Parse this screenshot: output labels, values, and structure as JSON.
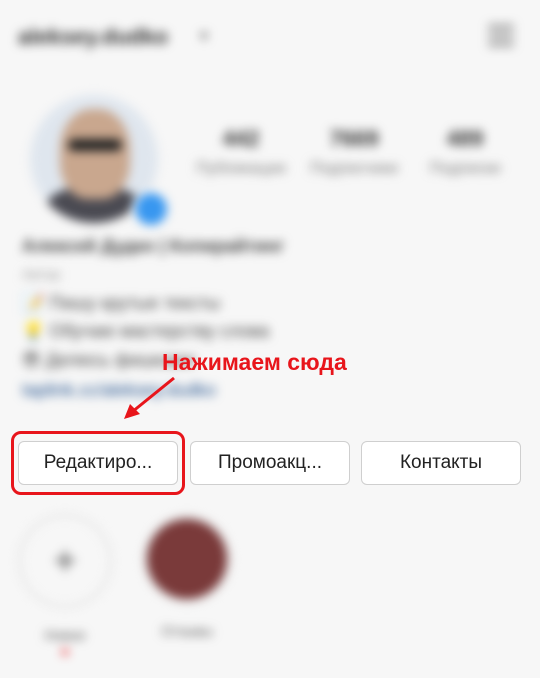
{
  "header": {
    "username": "aleksey.dudko",
    "chevron_icon": "chevron-down-icon",
    "menu_icon": "hamburger-menu-icon"
  },
  "profile": {
    "avatar_icon": "profile-photo",
    "add_story_icon": "plus-badge-icon",
    "stats": [
      {
        "value": "442",
        "label": "Публикации"
      },
      {
        "value": "7669",
        "label": "Подписчики"
      },
      {
        "value": "489",
        "label": "Подписки"
      }
    ]
  },
  "bio": {
    "name": "Алексей Дудко | Копирайтинг",
    "category": "Автор",
    "line1": "📝 Пишу крутые тексты",
    "line2": "💡 Обучаю мастерству слова",
    "line3": "😎 Делюсь фишками",
    "link": "taplink.cc/aleksey.dudko"
  },
  "annotation": {
    "text": "Нажимаем сюда",
    "color": "#e8151b"
  },
  "buttons": {
    "edit": "Редактиро...",
    "promo": "Промоакц...",
    "contacts": "Контакты"
  },
  "stories": [
    {
      "caption": "Новое",
      "icon": "plus-icon"
    },
    {
      "caption": "Отзывы",
      "icon": "story-cover"
    }
  ]
}
